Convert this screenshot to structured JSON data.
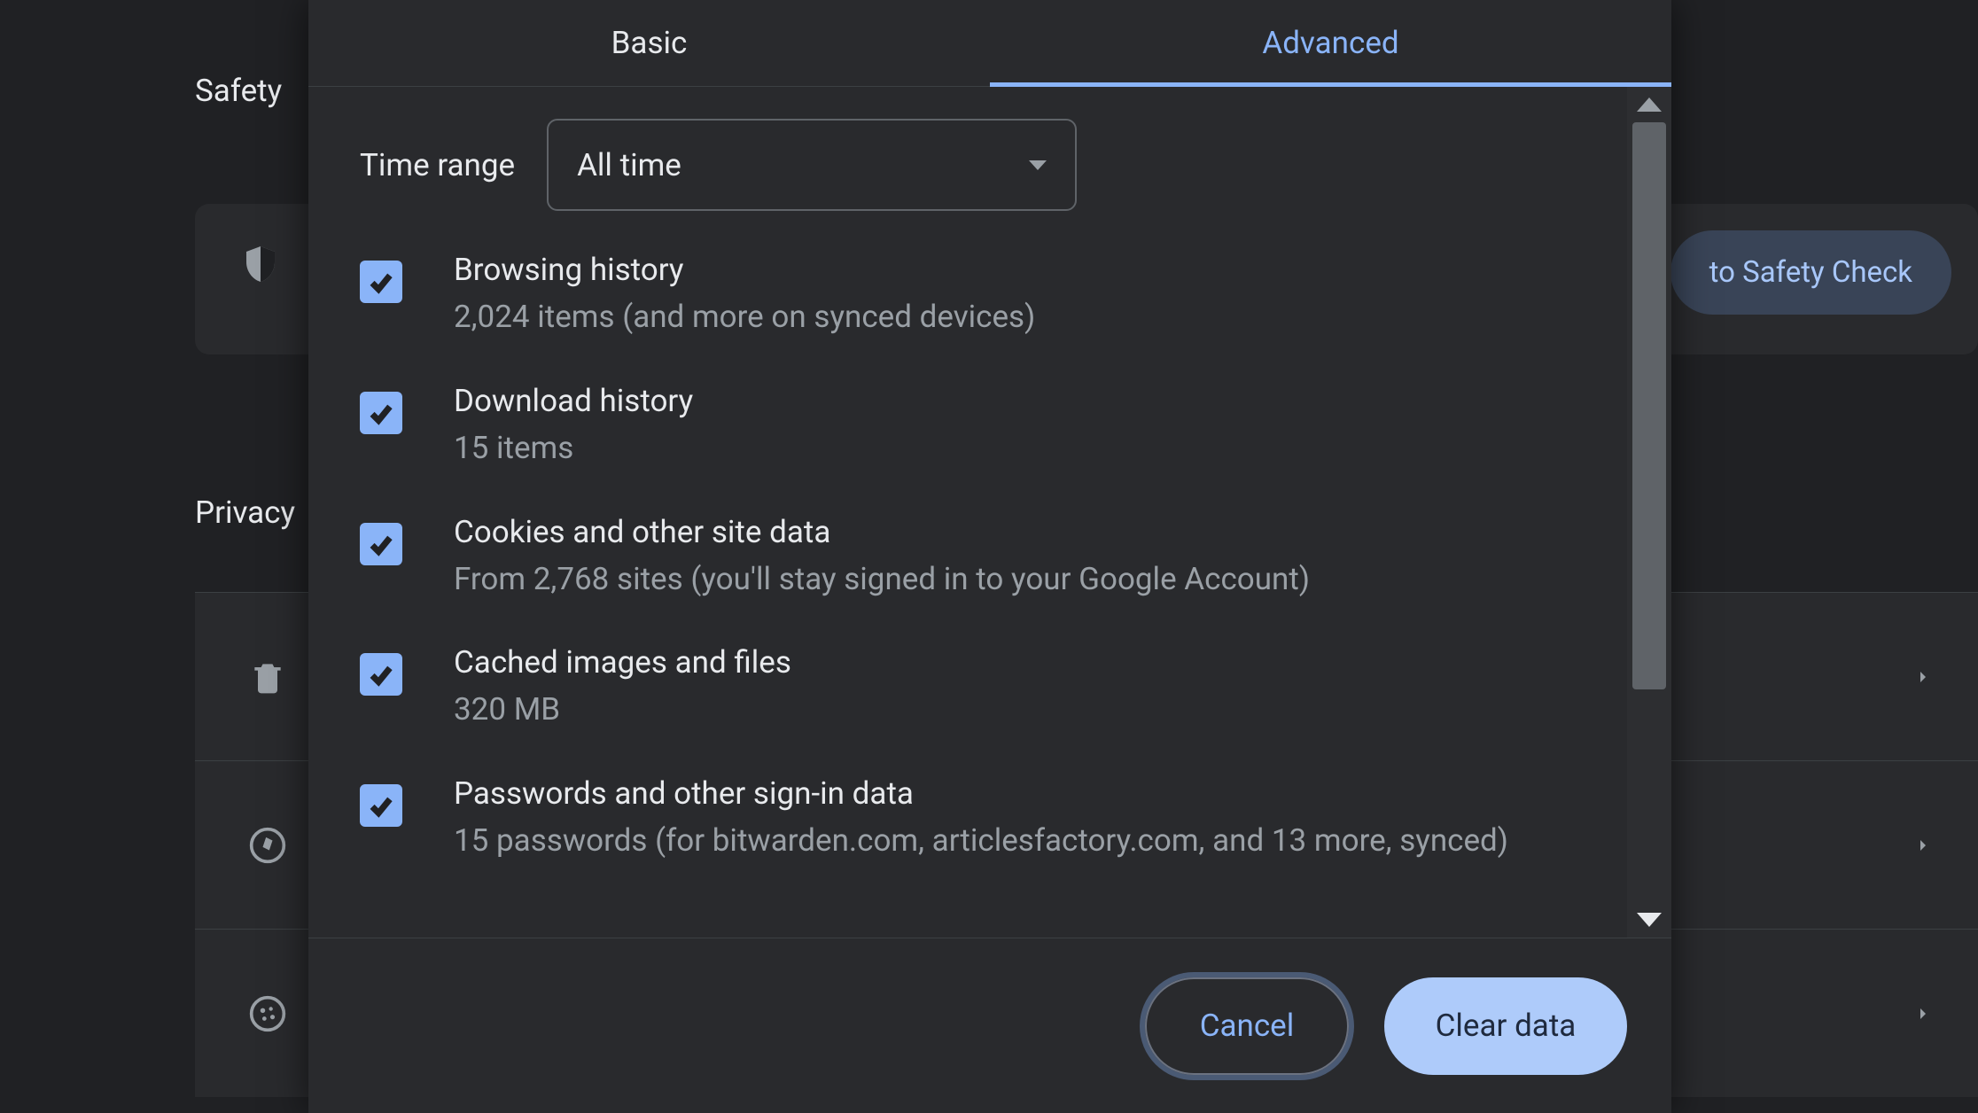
{
  "background": {
    "safety_heading": "Safety",
    "privacy_heading": "Privacy",
    "safety_check_button": "to Safety Check"
  },
  "dialog": {
    "tabs": {
      "basic": "Basic",
      "advanced": "Advanced",
      "active": "advanced"
    },
    "time_range": {
      "label": "Time range",
      "selected": "All time"
    },
    "items": [
      {
        "title": "Browsing history",
        "sub": "2,024 items (and more on synced devices)",
        "checked": true
      },
      {
        "title": "Download history",
        "sub": "15 items",
        "checked": true
      },
      {
        "title": "Cookies and other site data",
        "sub": "From 2,768 sites (you'll stay signed in to your Google Account)",
        "checked": true
      },
      {
        "title": "Cached images and files",
        "sub": "320 MB",
        "checked": true
      },
      {
        "title": "Passwords and other sign-in data",
        "sub": "15 passwords (for bitwarden.com, articlesfactory.com, and 13 more, synced)",
        "checked": true
      }
    ],
    "buttons": {
      "cancel": "Cancel",
      "clear": "Clear data"
    }
  }
}
